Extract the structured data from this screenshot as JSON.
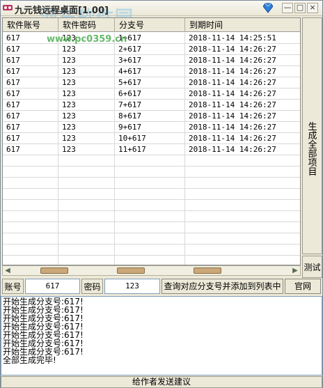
{
  "window": {
    "title": "九元钱远程桌面[1.00]",
    "watermark": "河东软件园",
    "watermark_url": "www.pc0359.cn",
    "min_label": "—",
    "max_label": "□",
    "close_label": "×"
  },
  "table": {
    "columns": [
      "软件账号",
      "软件密码",
      "分支号",
      "到期时间"
    ],
    "rows": [
      [
        "617",
        "123",
        "1+617",
        "2018-11-14  14:25:51"
      ],
      [
        "617",
        "123",
        "2+617",
        "2018-11-14  14:26:27"
      ],
      [
        "617",
        "123",
        "3+617",
        "2018-11-14  14:26:27"
      ],
      [
        "617",
        "123",
        "4+617",
        "2018-11-14  14:26:27"
      ],
      [
        "617",
        "123",
        "5+617",
        "2018-11-14  14:26:27"
      ],
      [
        "617",
        "123",
        "6+617",
        "2018-11-14  14:26:27"
      ],
      [
        "617",
        "123",
        "7+617",
        "2018-11-14  14:26:27"
      ],
      [
        "617",
        "123",
        "8+617",
        "2018-11-14  14:26:27"
      ],
      [
        "617",
        "123",
        "9+617",
        "2018-11-14  14:26:27"
      ],
      [
        "617",
        "123",
        "10+617",
        "2018-11-14  14:26:27"
      ],
      [
        "617",
        "123",
        "11+617",
        "2018-11-14  14:26:27"
      ]
    ]
  },
  "side": {
    "generate_all_label": "生成全部项目",
    "test_label": "测试"
  },
  "form": {
    "account_label": "账号",
    "account_value": "617",
    "password_label": "密码",
    "password_value": "123",
    "query_button": "查询对应分支号并添加到列表中",
    "official_button": "官网"
  },
  "log": {
    "lines": [
      "开始生成分支号:617!",
      "开始生成分支号:617!",
      "开始生成分支号:617!",
      "开始生成分支号:617!",
      "开始生成分支号:617!",
      "开始生成分支号:617!",
      "开始生成分支号:617!",
      "全部生成完毕!"
    ]
  },
  "feedback_button": "给作者发送建议",
  "colors": {
    "window_bg": "#ece9d8",
    "watermark": "#8ec8e8",
    "watermark_url": "#4caf50",
    "scroll_thumb": "#caa87a"
  }
}
